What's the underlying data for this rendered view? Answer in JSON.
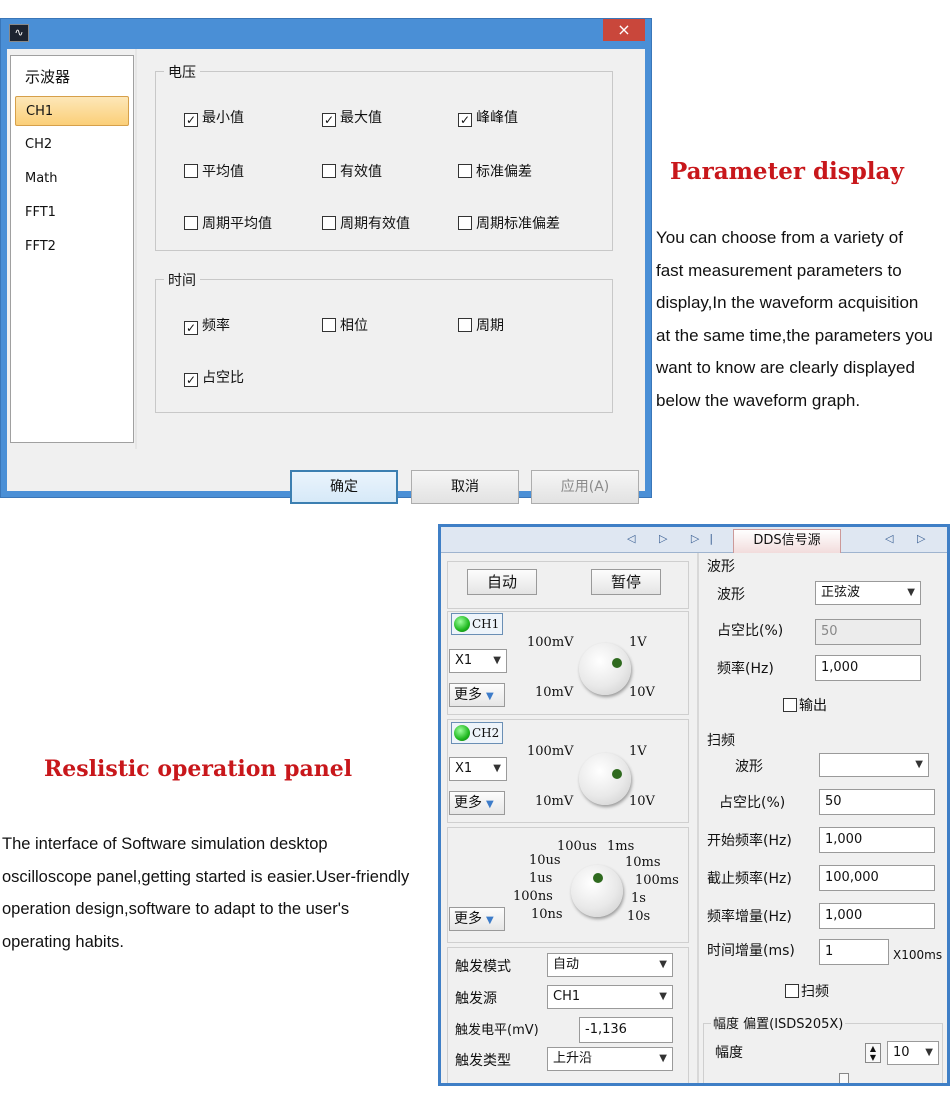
{
  "dialog": {
    "close_glyph": "×",
    "nav": [
      "示波器",
      "CH1",
      "CH2",
      "Math",
      "FFT1",
      "FFT2"
    ],
    "voltage_group": "电压",
    "voltage_items": [
      {
        "label": "最小值",
        "checked": true
      },
      {
        "label": "最大值",
        "checked": true
      },
      {
        "label": "峰峰值",
        "checked": true
      },
      {
        "label": "平均值",
        "checked": false
      },
      {
        "label": "有效值",
        "checked": false
      },
      {
        "label": "标准偏差",
        "checked": false
      },
      {
        "label": "周期平均值",
        "checked": false
      },
      {
        "label": "周期有效值",
        "checked": false
      },
      {
        "label": "周期标准偏差",
        "checked": false
      }
    ],
    "time_group": "时间",
    "time_items": [
      {
        "label": "频率",
        "checked": true
      },
      {
        "label": "相位",
        "checked": false
      },
      {
        "label": "周期",
        "checked": false
      },
      {
        "label": "占空比",
        "checked": true
      }
    ],
    "buttons": {
      "ok": "确定",
      "cancel": "取消",
      "apply": "应用(A)"
    }
  },
  "section1": {
    "heading": "Parameter display",
    "lines": [
      "You can choose from a variety of",
      "fast measurement parameters to",
      "display,In the waveform acquisition",
      "at the same time,the parameters you",
      "want to know are clearly displayed",
      "below the waveform graph."
    ]
  },
  "section2": {
    "heading": "Reslistic operation panel",
    "lines": [
      "The interface of Software simulation desktop",
      "oscilloscope panel,getting started is easier.User-friendly",
      "operation design,software to adapt to the user's",
      "operating habits."
    ]
  },
  "panel": {
    "tab_arrows_left": "◁ ▷ ▷| |◁",
    "tab_dds": "DDS信号源",
    "tab_arrows_right": "◁ ▷ ▷|",
    "auto_btn": "自动",
    "pause_btn": "暂停",
    "ch1": {
      "label": "CH1",
      "probe": "X1",
      "more": "更多",
      "scale": [
        "100mV",
        "1V",
        "10mV",
        "10V"
      ]
    },
    "ch2": {
      "label": "CH2",
      "probe": "X1",
      "more": "更多",
      "scale": [
        "100mV",
        "1V",
        "10mV",
        "10V"
      ]
    },
    "time_more": "更多",
    "time_scale": [
      "100us",
      "1ms",
      "10us",
      "10ms",
      "1us",
      "100ms",
      "100ns",
      "1s",
      "10ns",
      "10s"
    ],
    "trigger": {
      "mode_label": "触发模式",
      "mode_value": "自动",
      "source_label": "触发源",
      "source_value": "CH1",
      "level_label": "触发电平(mV)",
      "level_value": "-1,136",
      "type_label": "触发类型",
      "type_value": "上升沿"
    },
    "wave": {
      "group": "波形",
      "wave_label": "波形",
      "wave_value": "正弦波",
      "duty_label": "占空比(%)",
      "duty_value": "50",
      "freq_label": "频率(Hz)",
      "freq_value": "1,000",
      "output_label": "输出"
    },
    "sweep": {
      "group": "扫频",
      "wave_label": "波形",
      "wave_value": "",
      "duty_label": "占空比(%)",
      "duty_value": "50",
      "start_label": "开始频率(Hz)",
      "start_value": "1,000",
      "stop_label": "截止频率(Hz)",
      "stop_value": "100,000",
      "step_label": "频率增量(Hz)",
      "step_value": "1,000",
      "time_label": "时间增量(ms)",
      "time_value": "1",
      "time_unit": "X100ms",
      "sweep_check": "扫频"
    },
    "amp": {
      "group": "幅度 偏置(ISDS205X)",
      "amp_label": "幅度",
      "amp_value": "10"
    }
  }
}
